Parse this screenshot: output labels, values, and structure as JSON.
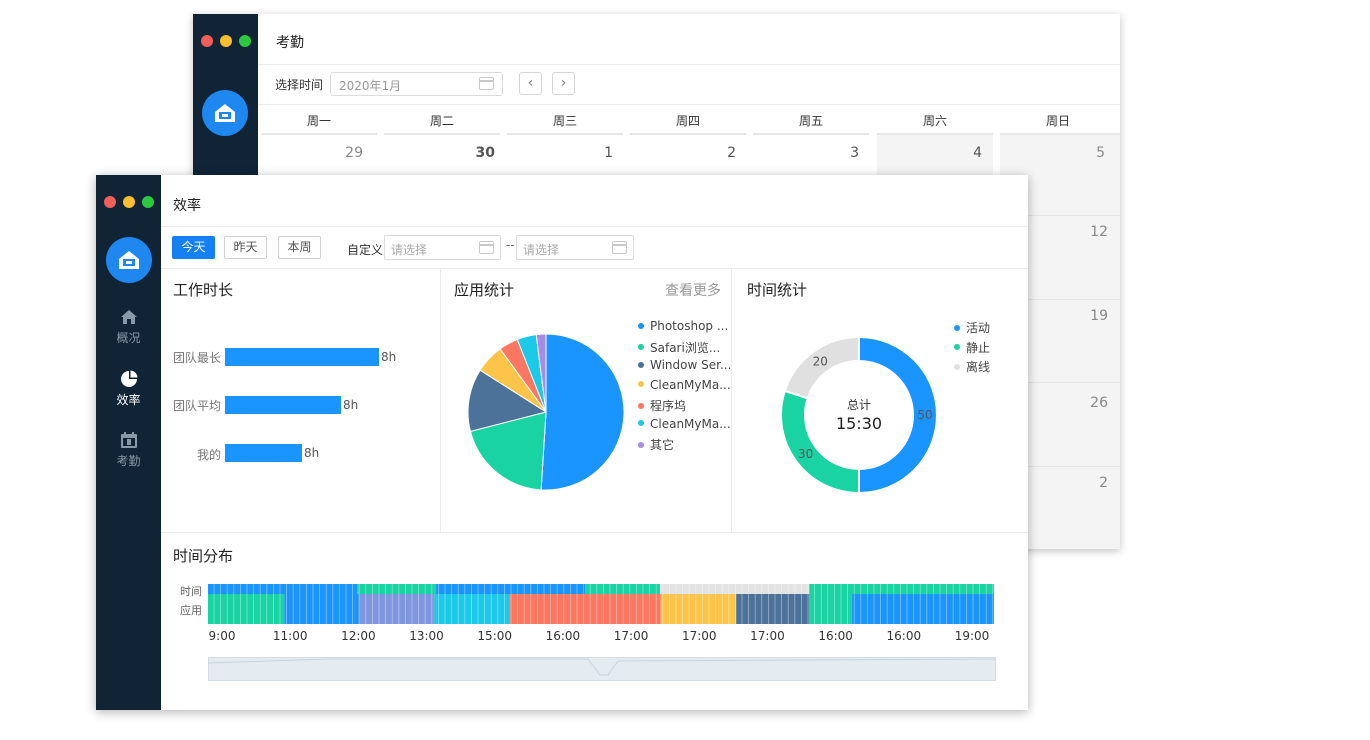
{
  "back_window": {
    "title": "考勤",
    "select_label": "选择时间",
    "month_value": "2020年1月",
    "prev_label": "‹",
    "next_label": "›",
    "weekdays": [
      "周一",
      "周二",
      "周三",
      "周四",
      "周五",
      "周六",
      "周日"
    ],
    "days_row1": [
      "29",
      "30",
      "1",
      "2",
      "3",
      "4",
      "5"
    ],
    "days_right_col": [
      "12",
      "19",
      "26",
      "2"
    ]
  },
  "front_window": {
    "title": "效率",
    "nav": [
      {
        "label": "概况",
        "icon": "home-icon",
        "active": false
      },
      {
        "label": "效率",
        "icon": "pie-chart-icon",
        "active": true
      },
      {
        "label": "考勤",
        "icon": "calendar-icon",
        "active": false
      }
    ],
    "filters": {
      "today": "今天",
      "yesterday": "昨天",
      "this_week": "本周",
      "custom_label": "自定义",
      "placeholder_start": "请选择",
      "placeholder_end": "请选择",
      "separator": "--"
    },
    "work_duration": {
      "title": "工作时长",
      "rows": [
        {
          "label": "团队最长",
          "value": "8h",
          "fraction": 1.0
        },
        {
          "label": "团队平均",
          "value": "8h",
          "fraction": 0.75
        },
        {
          "label": "我的",
          "value": "8h",
          "fraction": 0.5
        }
      ]
    },
    "app_stats": {
      "title": "应用统计",
      "more": "查看更多",
      "slices": [
        {
          "name": "Photoshop ...",
          "value": 51,
          "color": "#1a95ff"
        },
        {
          "name": "Safari浏览...",
          "value": 20,
          "color": "#19d3a3"
        },
        {
          "name": "Window Ser...",
          "value": 13,
          "color": "#4d7299"
        },
        {
          "name": "CleanMyMa...",
          "value": 6,
          "color": "#fcc54a"
        },
        {
          "name": "程序坞",
          "value": 4,
          "color": "#fb7762"
        },
        {
          "name": "CleanMyMa...",
          "value": 4,
          "color": "#1cc9e8"
        },
        {
          "name": "其它",
          "value": 2,
          "color": "#a98ae5"
        }
      ]
    },
    "time_stats": {
      "title": "时间统计",
      "center_label": "总计",
      "center_value": "15:30",
      "slices": [
        {
          "name": "活动",
          "value": 50,
          "color": "#1a95ff"
        },
        {
          "name": "静止",
          "value": 30,
          "color": "#19d3a3"
        },
        {
          "name": "离线",
          "value": 20,
          "color": "#e0e0e0"
        }
      ]
    },
    "distribution": {
      "title": "时间分布",
      "row_labels": [
        "时间",
        "应用"
      ],
      "ticks": [
        "9:00",
        "11:00",
        "12:00",
        "13:00",
        "15:00",
        "16:00",
        "17:00",
        "17:00",
        "17:00",
        "16:00",
        "16:00",
        "19:00"
      ],
      "time_segments": [
        {
          "share": 0.19,
          "color": "#1a95ff"
        },
        {
          "share": 0.1,
          "color": "#19d3a3"
        },
        {
          "share": 0.19,
          "color": "#1a95ff"
        },
        {
          "share": 0.095,
          "color": "#19d3a3"
        },
        {
          "share": 0.19,
          "color": "#e3e3e3"
        },
        {
          "share": 0.235,
          "color": "#19d3a3"
        }
      ],
      "app_segments": [
        {
          "share": 0.097,
          "color": "#19d3a3"
        },
        {
          "share": 0.095,
          "color": "#1a95ff"
        },
        {
          "share": 0.096,
          "color": "#7f95dd"
        },
        {
          "share": 0.095,
          "color": "#1cc9e8"
        },
        {
          "share": 0.193,
          "color": "#fb7762"
        },
        {
          "share": 0.096,
          "color": "#fcc54a"
        },
        {
          "share": 0.093,
          "color": "#4d7299"
        },
        {
          "share": 0.054,
          "color": "#19d3a3"
        },
        {
          "share": 0.181,
          "color": "#1a95ff"
        }
      ]
    }
  }
}
